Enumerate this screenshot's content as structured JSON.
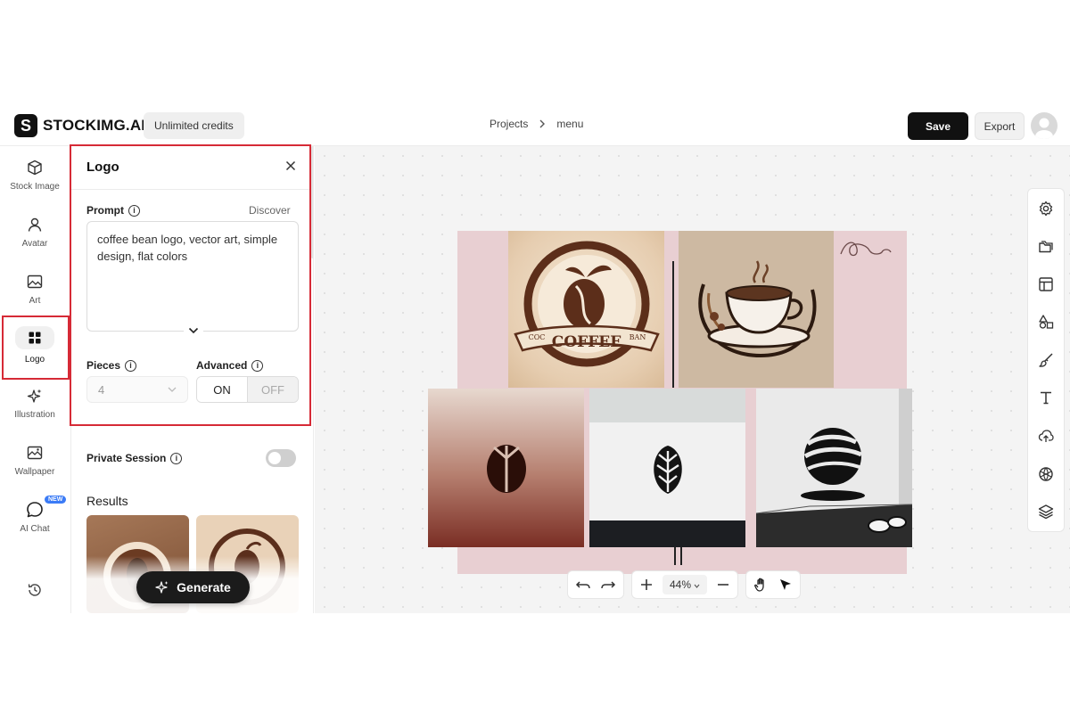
{
  "header": {
    "brand_mark": "S",
    "brand_name": "STOCKIMG.AI",
    "credits": "Unlimited credits",
    "breadcrumb": [
      "Projects",
      "menu"
    ],
    "save_label": "Save",
    "export_label": "Export"
  },
  "rail": {
    "items": [
      {
        "label": "Stock Image",
        "icon": "cube-icon"
      },
      {
        "label": "Avatar",
        "icon": "person-icon"
      },
      {
        "label": "Art",
        "icon": "image-icon"
      },
      {
        "label": "Logo",
        "icon": "grid-icon",
        "active": true
      },
      {
        "label": "Illustration",
        "icon": "sparkle-icon"
      },
      {
        "label": "Wallpaper",
        "icon": "wallpaper-icon"
      },
      {
        "label": "AI Chat",
        "icon": "chat-icon",
        "badge": "NEW"
      }
    ],
    "history_icon": "history-icon"
  },
  "panel": {
    "title": "Logo",
    "prompt_label": "Prompt",
    "discover_label": "Discover",
    "prompt_text": "coffee bean logo, vector art, simple design, flat colors",
    "pieces_label": "Pieces",
    "pieces_value": "4",
    "advanced_label": "Advanced",
    "advanced_on": "ON",
    "advanced_off": "OFF",
    "private_label": "Private Session",
    "private_enabled": false,
    "results_label": "Results",
    "generate_label": "Generate"
  },
  "canvas": {
    "logo_text_coffee": "COFFEE",
    "logo_text_left": "COC",
    "logo_text_right": "BAN",
    "zoom": "44%"
  },
  "colors": {
    "accent": "#111111",
    "highlight": "#d62a36",
    "board": "#e8cfd2",
    "badge": "#3b7bf6"
  }
}
